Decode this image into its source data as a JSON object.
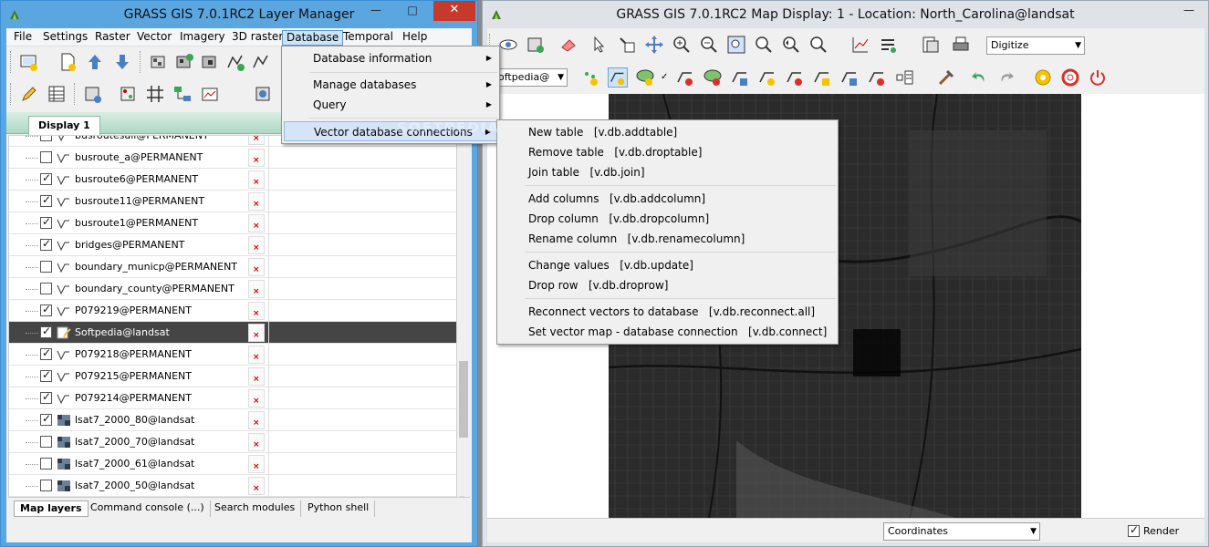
{
  "layer_manager": {
    "title": "GRASS GIS 7.0.1RC2 Layer Manager",
    "menu": [
      "File",
      "Settings",
      "Raster",
      "Vector",
      "Imagery",
      "3D raster",
      "Database",
      "Temporal",
      "Help"
    ],
    "display_tab": "Display 1",
    "layers": [
      {
        "name": "busroutesall@PERMANENT",
        "checked": false,
        "kind": "vector"
      },
      {
        "name": "busroute_a@PERMANENT",
        "checked": false,
        "kind": "vector"
      },
      {
        "name": "busroute6@PERMANENT",
        "checked": true,
        "kind": "vector"
      },
      {
        "name": "busroute11@PERMANENT",
        "checked": true,
        "kind": "vector"
      },
      {
        "name": "busroute1@PERMANENT",
        "checked": true,
        "kind": "vector"
      },
      {
        "name": "bridges@PERMANENT",
        "checked": true,
        "kind": "vector"
      },
      {
        "name": "boundary_municp@PERMANENT",
        "checked": false,
        "kind": "vector"
      },
      {
        "name": "boundary_county@PERMANENT",
        "checked": false,
        "kind": "vector"
      },
      {
        "name": "P079219@PERMANENT",
        "checked": true,
        "kind": "vector"
      },
      {
        "name": "Softpedia@landsat",
        "checked": true,
        "kind": "edit",
        "selected": true
      },
      {
        "name": "P079218@PERMANENT",
        "checked": true,
        "kind": "vector"
      },
      {
        "name": "P079215@PERMANENT",
        "checked": true,
        "kind": "vector"
      },
      {
        "name": "P079214@PERMANENT",
        "checked": true,
        "kind": "vector"
      },
      {
        "name": "lsat7_2000_80@landsat",
        "checked": true,
        "kind": "raster"
      },
      {
        "name": "lsat7_2000_70@landsat",
        "checked": false,
        "kind": "raster"
      },
      {
        "name": "lsat7_2000_61@landsat",
        "checked": false,
        "kind": "raster"
      },
      {
        "name": "lsat7_2000_50@landsat",
        "checked": false,
        "kind": "raster"
      }
    ],
    "bottom_tabs": [
      "Map layers",
      "Command console (...)",
      "Search modules",
      "Python shell"
    ]
  },
  "map_display": {
    "title": "GRASS GIS 7.0.1RC2 Map Display: 1  - Location: North_Carolina@landsat",
    "digitize_combo": "Digitize",
    "layer_combo": "Softpedia@",
    "coordinates_combo": "Coordinates",
    "render_label": "Render",
    "render_checked": true
  },
  "database_menu": {
    "items": [
      {
        "label": "Database information",
        "submenu": true
      },
      {
        "label": "Manage databases",
        "submenu": true
      },
      {
        "label": "Query",
        "submenu": true
      },
      {
        "label": "Vector database connections",
        "submenu": true,
        "highlighted": true
      }
    ]
  },
  "vector_db_submenu": {
    "groups": [
      [
        {
          "label": "New table",
          "cmd": "[v.db.addtable]"
        },
        {
          "label": "Remove table",
          "cmd": "[v.db.droptable]"
        },
        {
          "label": "Join table",
          "cmd": "[v.db.join]"
        }
      ],
      [
        {
          "label": "Add columns",
          "cmd": "[v.db.addcolumn]"
        },
        {
          "label": "Drop column",
          "cmd": "[v.db.dropcolumn]"
        },
        {
          "label": "Rename column",
          "cmd": "[v.db.renamecolumn]"
        }
      ],
      [
        {
          "label": "Change values",
          "cmd": "[v.db.update]"
        },
        {
          "label": "Drop row",
          "cmd": "[v.db.droprow]"
        }
      ],
      [
        {
          "label": "Reconnect vectors to database",
          "cmd": "[v.db.reconnect.all]"
        },
        {
          "label": "Set vector map - database connection",
          "cmd": "[v.db.connect]"
        }
      ]
    ]
  },
  "watermark": "SOFTPEDIA",
  "colors": {
    "accent": "#3b8fd6",
    "close": "#c7392b",
    "menu_highlight": "#d5e5f7",
    "selected_row": "#454545"
  }
}
